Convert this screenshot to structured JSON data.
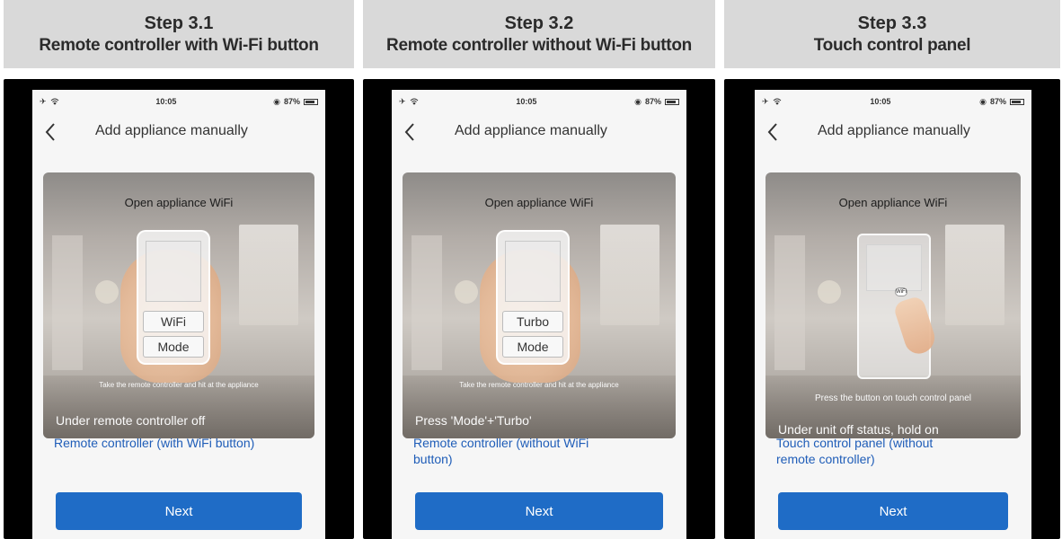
{
  "steps": [
    {
      "title": "Step 3.1",
      "subtitle": "Remote controller with Wi-Fi button",
      "status": {
        "time": "10:05",
        "battery": "87%"
      },
      "nav_title": "Add appliance manually",
      "illus_title": "Open appliance WiFi",
      "buttons": [
        "WiFi",
        "Mode"
      ],
      "caption": "Take the remote controller and hit at the appliance",
      "note": "Under remote controller off",
      "link": "Remote controller (with WiFi button)",
      "next": "Next"
    },
    {
      "title": "Step 3.2",
      "subtitle": "Remote controller without Wi-Fi button",
      "status": {
        "time": "10:05",
        "battery": "87%"
      },
      "nav_title": "Add appliance manually",
      "illus_title": "Open appliance WiFi",
      "buttons": [
        "Turbo",
        "Mode"
      ],
      "caption": "Take the remote controller and hit at the appliance",
      "note": "Press 'Mode'+'Turbo'",
      "link": "Remote controller (without WiFi button)",
      "next": "Next"
    },
    {
      "title": "Step 3.3",
      "subtitle": "Touch control panel",
      "status": {
        "time": "10:05",
        "battery": "87%"
      },
      "nav_title": "Add appliance manually",
      "illus_title": "Open appliance WiFi",
      "touch_label": "WiFi",
      "caption": "Press the button on touch control panel",
      "note": "Under unit off status, hold on",
      "link": "Touch control panel (without remote controller)",
      "next": "Next"
    }
  ],
  "colors": {
    "accent": "#1f6cc6",
    "link": "#1f5db8",
    "header_bg": "#d9d9d9"
  },
  "icons": {
    "airplane": "airplane-mode-icon",
    "wifi": "wifi-signal-icon",
    "back": "chevron-left-icon",
    "battery": "battery-icon",
    "alarm": "alarm-icon"
  }
}
